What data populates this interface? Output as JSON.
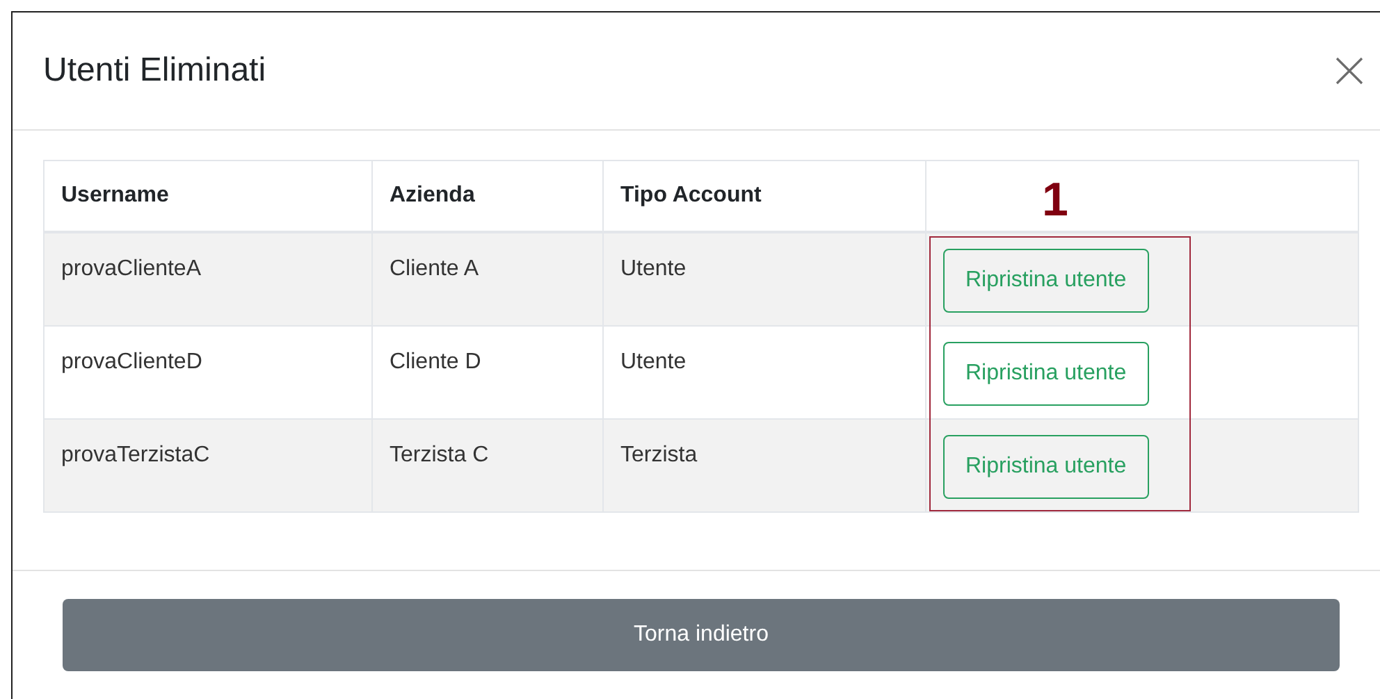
{
  "dialog": {
    "title": "Utenti Eliminati"
  },
  "table": {
    "columns": [
      "Username",
      "Azienda",
      "Tipo Account"
    ],
    "rows": [
      {
        "cells": [
          "provaClienteA",
          "Cliente A",
          "Utente"
        ],
        "action": "Ripristina utente"
      },
      {
        "cells": [
          "provaClienteD",
          "Cliente D",
          "Utente"
        ],
        "action": "Ripristina utente"
      },
      {
        "cells": [
          "provaTerzistaC",
          "Terzista C",
          "Terzista"
        ],
        "action": "Ripristina utente"
      }
    ]
  },
  "annotation": {
    "label": "1"
  },
  "footer": {
    "button": "Torna indietro"
  }
}
